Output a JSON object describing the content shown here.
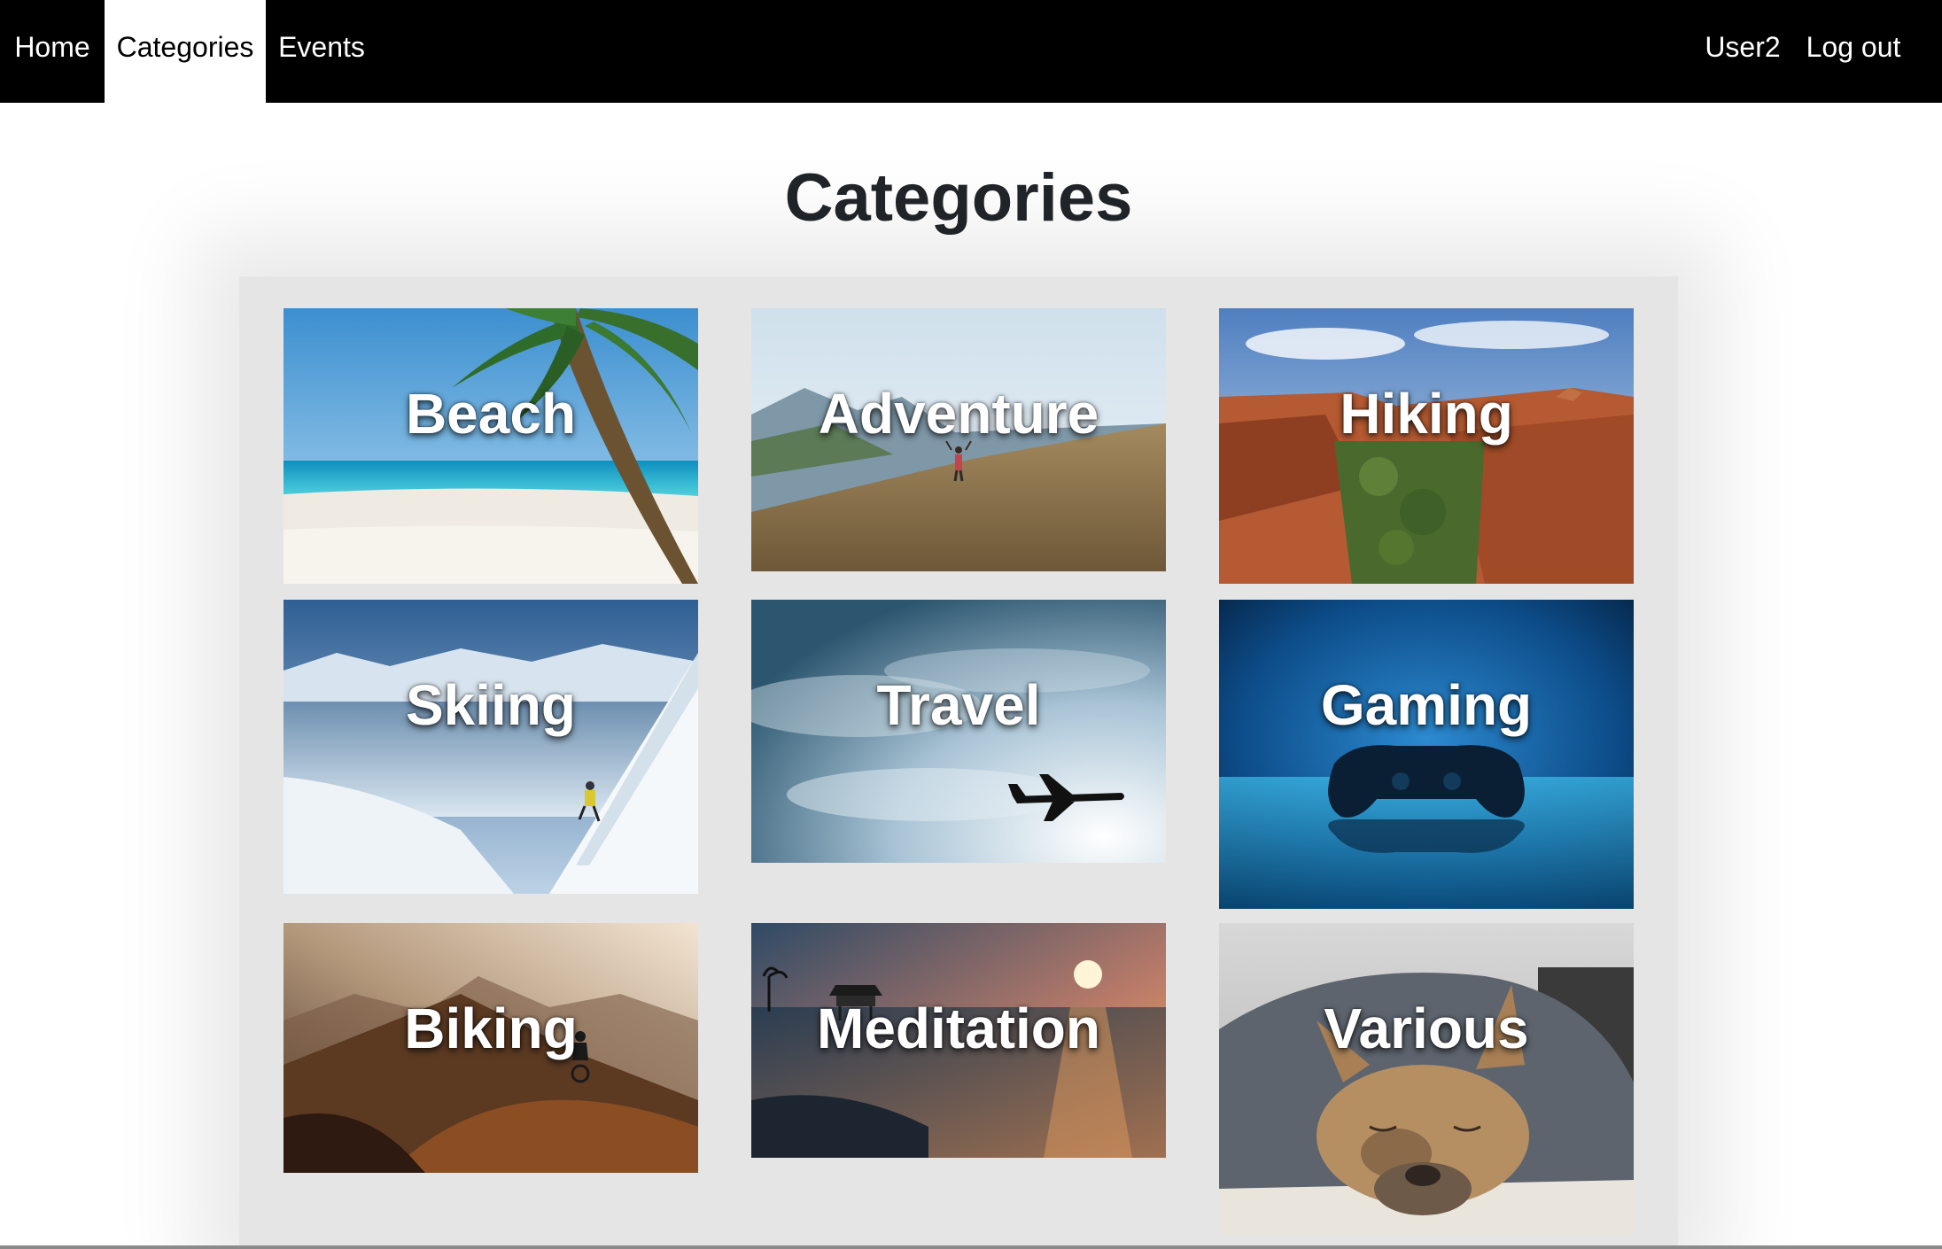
{
  "nav": {
    "home_label": "Home",
    "categories_label": "Categories",
    "events_label": "Events",
    "user_label": "User2",
    "logout_label": "Log out"
  },
  "page": {
    "title": "Categories"
  },
  "categories": [
    {
      "label": "Beach",
      "image": "palm-beach-photo"
    },
    {
      "label": "Adventure",
      "image": "mountain-hiker-photo"
    },
    {
      "label": "Hiking",
      "image": "red-canyon-photo"
    },
    {
      "label": "Skiing",
      "image": "ski-slope-photo"
    },
    {
      "label": "Travel",
      "image": "airplane-sky-photo"
    },
    {
      "label": "Gaming",
      "image": "game-controller-photo"
    },
    {
      "label": "Biking",
      "image": "mountain-biker-photo"
    },
    {
      "label": "Meditation",
      "image": "sunset-sea-photo"
    },
    {
      "label": "Various",
      "image": "sleeping-bulldog-photo"
    }
  ],
  "colors": {
    "navbar_bg": "#000000",
    "active_tab_bg": "#ffffff",
    "panel_bg": "#e5e5e5",
    "title_text": "#212529"
  }
}
